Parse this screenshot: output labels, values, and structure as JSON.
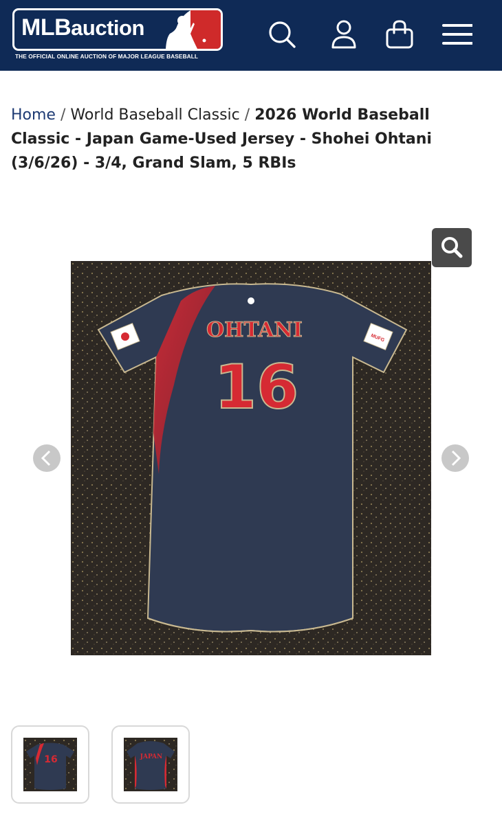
{
  "header": {
    "logo_text_mlb": "MLB",
    "logo_text_auction": "auction",
    "tagline": "THE OFFICIAL ONLINE AUCTION OF MAJOR LEAGUE BASEBALL",
    "icons": [
      "search-icon",
      "account-icon",
      "cart-icon",
      "menu-icon"
    ],
    "brand_color": "#0f2a56",
    "logo_red": "#cf2a2a"
  },
  "breadcrumb": {
    "home": "Home",
    "separator": "/",
    "category": "World Baseball Classic",
    "current": "2026 World Baseball Classic - Japan Game-Used Jersey - Shohei Ohtani (3/6/26) - 3/4, Grand Slam, 5 RBIs"
  },
  "gallery": {
    "jersey_name": "OHTANI",
    "jersey_number": "16",
    "sleeve_patch": "MUFG",
    "thumbnails": [
      {
        "view": "back",
        "jersey_text": "16"
      },
      {
        "view": "front",
        "jersey_text": "JAPAN"
      }
    ],
    "icons": [
      "zoom-icon",
      "chevron-left-icon",
      "chevron-right-icon"
    ]
  }
}
